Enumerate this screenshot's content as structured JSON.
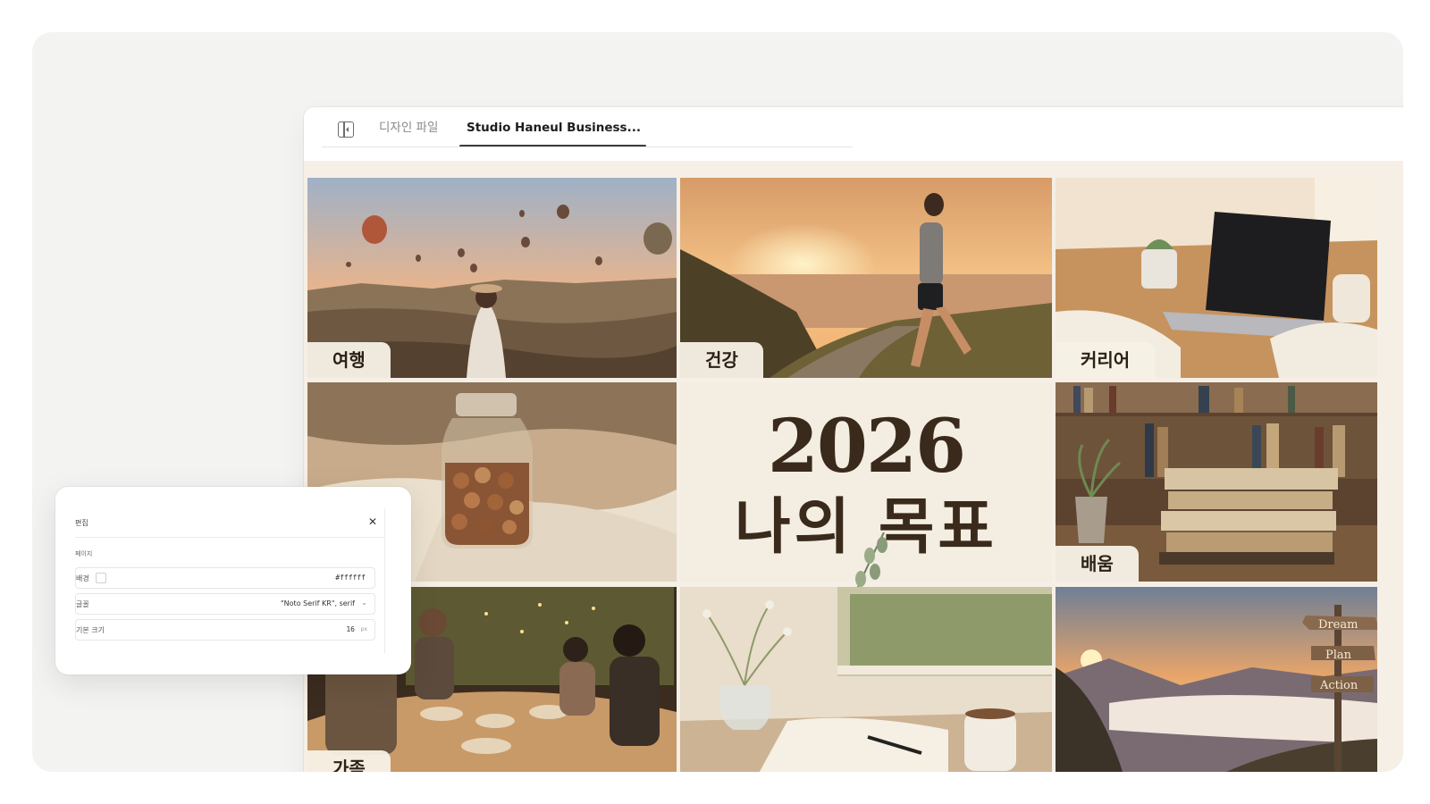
{
  "tabs": {
    "design_file": "디자인 파일",
    "active_document": "Studio Haneul Business..."
  },
  "board": {
    "year": "2026",
    "heading": "나의 목표",
    "tiles": [
      {
        "label": "여행"
      },
      {
        "label": "건강"
      },
      {
        "label": "커리어"
      },
      {
        "label": "배움"
      },
      {
        "label": "가족"
      }
    ],
    "signpost": [
      "Dream",
      "Plan",
      "Action"
    ]
  },
  "settings_panel": {
    "title": "편집",
    "section": "페이지",
    "background": {
      "label": "배경",
      "value": "#ffffff"
    },
    "font": {
      "label": "글꼴",
      "value": "\"Noto Serif KR\", serif"
    },
    "base_size": {
      "label": "기본 크기",
      "value": "16",
      "unit": "px"
    }
  },
  "colors": {
    "canvas_bg": "#f5efe6",
    "label_bg": "#f6f0e5",
    "heading_text": "#3a2a1b"
  }
}
